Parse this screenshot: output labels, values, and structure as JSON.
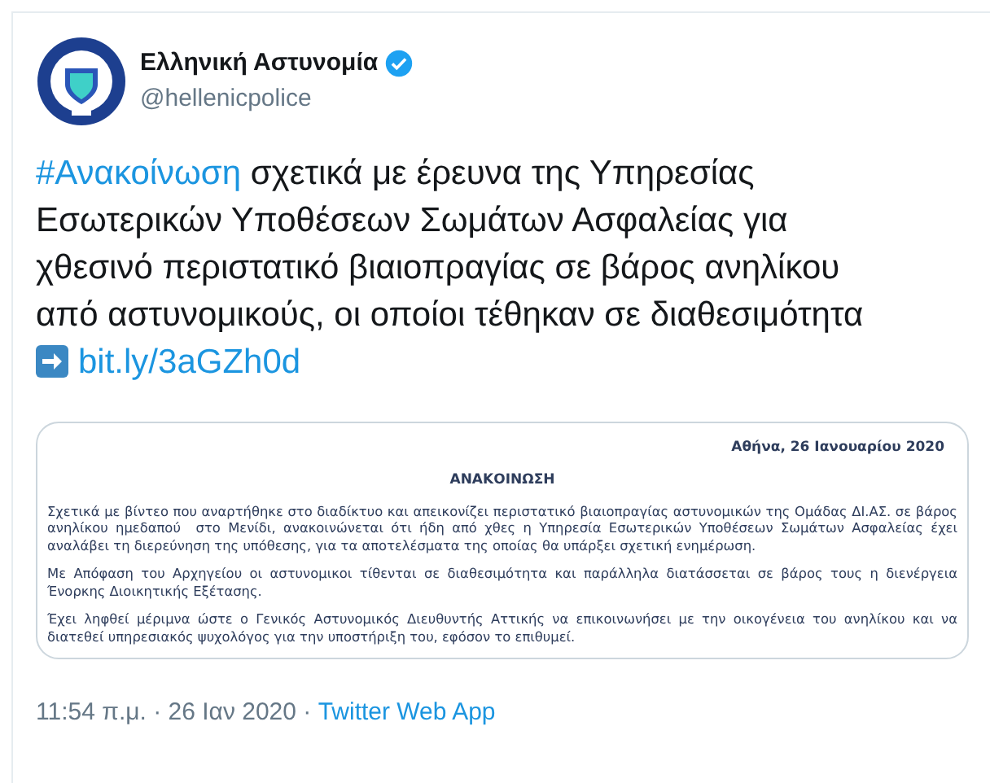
{
  "author": {
    "name": "Ελληνική Αστυνομία",
    "verified": true,
    "handle": "@hellenicpolice"
  },
  "tweet": {
    "parts": [
      {
        "kind": "hashtag",
        "text": "#Ανακοίνωση"
      },
      {
        "kind": "text",
        "text": " σχετικά με έρευνα της Υπηρεσίας Εσωτερικών Υποθέσεων Σωμάτων Ασφαλείας για χθεσινό περιστατικό βιαιοπραγίας σε βάρος ανηλίκου από αστυνομικούς, οι οποίοι τέθηκαν σε διαθεσιμότητα "
      },
      {
        "kind": "arrow"
      },
      {
        "kind": "link",
        "text": "bit.ly/3aGZh0d"
      }
    ]
  },
  "document": {
    "date": "Αθήνα, 26 Ιανουαρίου 2020",
    "title": "ΑΝΑΚΟΙΝΩΣΗ",
    "paragraphs": [
      "Σχετικά με βίντεο που αναρτήθηκε στο διαδίκτυο και απεικονίζει περιστατικό βιαιοπραγίας αστυνομικών της Ομάδας ΔΙ.ΑΣ. σε βάρος ανηλίκου ημεδαπού  στο Μενίδι, ανακοινώνεται ότι ήδη από χθες η Υπηρεσία Εσωτερικών Υποθέσεων Σωμάτων Ασφαλείας έχει αναλάβει τη διερεύνηση της υπόθεσης, για τα αποτελέσματα της οποίας θα υπάρξει σχετική ενημέρωση.",
      "Με Απόφαση του Αρχηγείου οι αστυνομικοι τίθενται σε διαθεσιμότητα και παράλληλα διατάσσεται σε βάρος τους η διενέργεια Ένορκης Διοικητικής Εξέτασης.",
      "Έχει ληφθεί μέριμνα ώστε ο Γενικός Αστυνομικός Διευθυντής Αττικής να επικοινωνήσει με την οικογένεια του ανηλίκου και να διατεθεί υπηρεσιακός ψυχολόγος για την υποστήριξη του, εφόσον το επιθυμεί."
    ]
  },
  "footer": {
    "time": "11:54 π.μ. · 26 Ιαν 2020 · ",
    "source": "Twitter Web App"
  }
}
